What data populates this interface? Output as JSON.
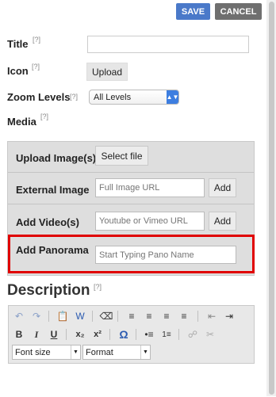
{
  "header": {
    "save_label": "SAVE",
    "cancel_label": "CANCEL"
  },
  "fields": {
    "title_label": "Title",
    "title_help": "[?]",
    "title_value": "",
    "icon_label": "Icon",
    "icon_help": "[?]",
    "icon_button": "Upload",
    "zoom_label": "Zoom Levels",
    "zoom_help": "[?]",
    "zoom_value": "All Levels",
    "media_label": "Media",
    "media_help": "[?]"
  },
  "media": {
    "upload_label": "Upload Image(s)",
    "upload_button": "Select file",
    "external_label": "External Image",
    "external_placeholder": "Full Image URL",
    "external_add": "Add",
    "video_label": "Add Video(s)",
    "video_placeholder": "Youtube or Vimeo URL",
    "video_add": "Add",
    "pano_label": "Add Panorama",
    "pano_placeholder": "Start Typing Pano Name"
  },
  "description": {
    "title": "Description",
    "help": "[?]",
    "font_size_label": "Font size",
    "format_label": "Format"
  }
}
